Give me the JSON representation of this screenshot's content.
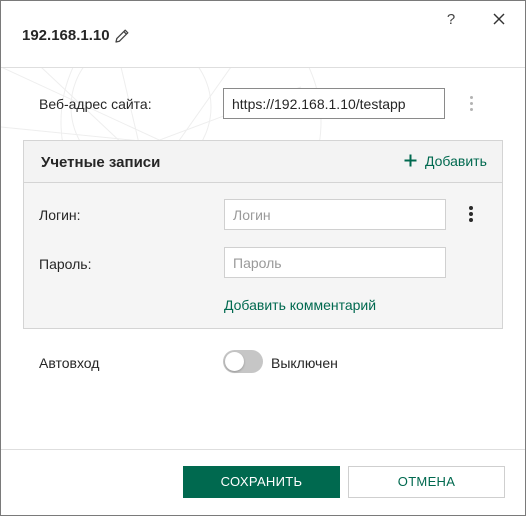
{
  "header": {
    "title": "192.168.1.10",
    "edit_icon": "pencil-icon",
    "help_symbol": "?",
    "help_icon": "question-icon",
    "close_icon": "close-icon"
  },
  "site": {
    "label": "Веб-адрес сайта:",
    "value": "https://192.168.1.10/testapp",
    "menu_icon": "more-vertical-icon"
  },
  "accounts": {
    "title": "Учетные записи",
    "add_label": "Добавить",
    "add_icon": "plus-icon",
    "login_label": "Логин:",
    "login_placeholder": "Логин",
    "login_value": "",
    "password_label": "Пароль:",
    "password_placeholder": "Пароль",
    "password_value": "",
    "menu_icon": "more-vertical-icon",
    "add_comment_label": "Добавить комментарий"
  },
  "autologin": {
    "label": "Автовход",
    "state_label": "Выключен",
    "enabled": false
  },
  "footer": {
    "save_label": "СОХРАНИТЬ",
    "cancel_label": "ОТМЕНА"
  },
  "colors": {
    "accent": "#00694f",
    "toggle_off": "#c6c6c6",
    "panel_bg": "#f5f5f5"
  }
}
